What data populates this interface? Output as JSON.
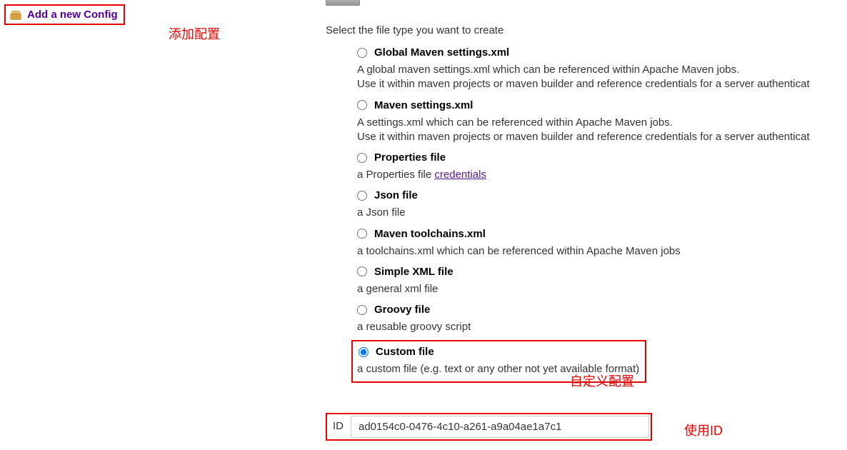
{
  "sidebar": {
    "add_config_label": "Add a new Config"
  },
  "annotations": {
    "add": "添加配置",
    "custom": "自定义配置",
    "use_id": "使用ID"
  },
  "main": {
    "prompt": "Select the file type you want to create",
    "options": [
      {
        "id": "global-maven",
        "label": "Global Maven settings.xml",
        "desc": "A global maven settings.xml which can be referenced within Apache Maven jobs.\nUse it within maven projects or maven builder and reference credentials for a server authenticat",
        "selected": false
      },
      {
        "id": "maven-settings",
        "label": "Maven settings.xml",
        "desc": "A settings.xml which can be referenced within Apache Maven jobs.\nUse it within maven projects or maven builder and reference credentials for a server authenticat",
        "selected": false
      },
      {
        "id": "properties",
        "label": "Properties file",
        "desc_prefix": "a Properties file ",
        "desc_link": "credentials",
        "selected": false
      },
      {
        "id": "json",
        "label": "Json file",
        "desc": "a Json file",
        "selected": false
      },
      {
        "id": "toolchains",
        "label": "Maven toolchains.xml",
        "desc": "a toolchains.xml which can be referenced within Apache Maven jobs",
        "selected": false
      },
      {
        "id": "simple-xml",
        "label": "Simple XML file",
        "desc": "a general xml file",
        "selected": false
      },
      {
        "id": "groovy",
        "label": "Groovy file",
        "desc": "a reusable groovy script",
        "selected": false
      },
      {
        "id": "custom",
        "label": "Custom file",
        "desc": "a custom file (e.g. text or any other not yet available format)",
        "selected": true
      }
    ],
    "id_label": "ID",
    "id_value": "ad0154c0-0476-4c10-a261-a9a04ae1a7c1"
  }
}
